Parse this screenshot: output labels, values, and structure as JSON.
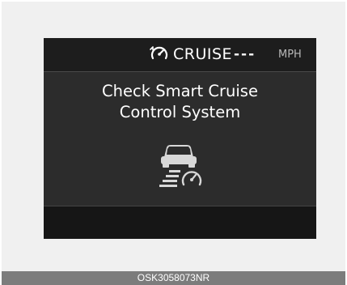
{
  "cluster": {
    "cruise_label": "CRUISE",
    "speed_value": "---",
    "speed_unit": "MPH",
    "cruise_icon": "cruise-control-icon",
    "message_line1": "Check Smart Cruise",
    "message_line2": "Control System",
    "warning_icon": "smart-cruise-warning-icon"
  },
  "caption": {
    "code": "OSK3058073NR"
  },
  "colors": {
    "display_background": "#2c2c2c",
    "top_bar": "#1d1d1d",
    "bottom_bar": "#161616",
    "text": "#ffffff",
    "unit_text": "#b8b8b8",
    "caption_bar": "#7c7c7c"
  }
}
